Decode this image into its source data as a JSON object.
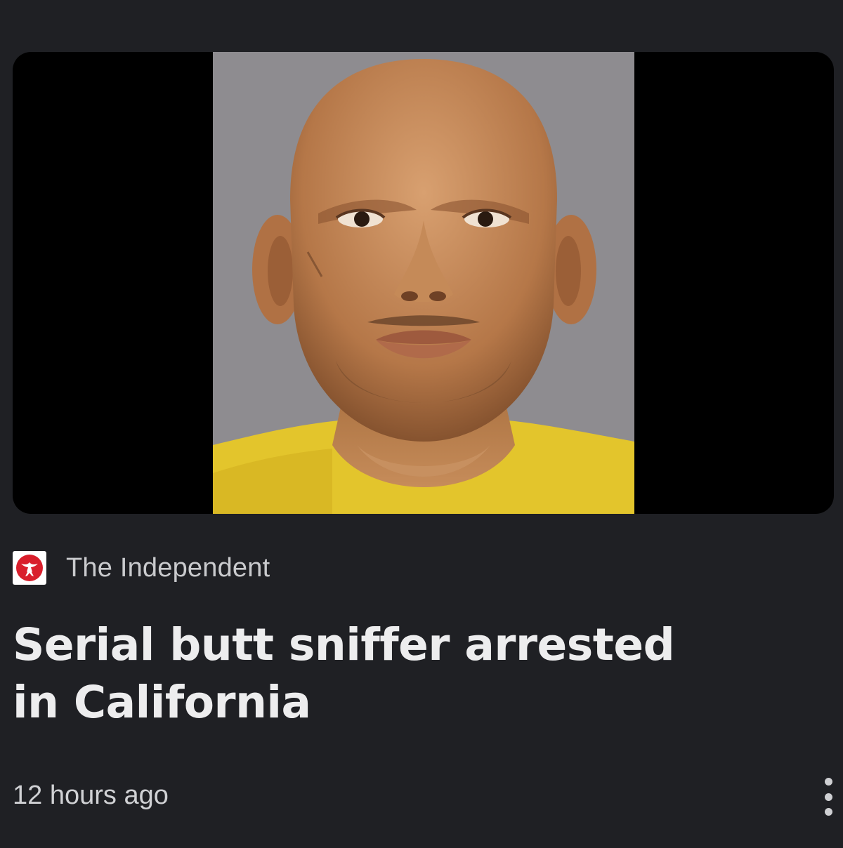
{
  "article": {
    "source_name": "The Independent",
    "headline": "Serial butt sniffer arrested in California",
    "timestamp": "12 hours ago"
  },
  "icons": {
    "source_logo": "eagle-logo-icon",
    "more_menu": "more-vert-icon"
  },
  "colors": {
    "background": "#1f2024",
    "logo_red": "#d91f2c",
    "photo_backdrop": "#8d8b8e",
    "shirt_yellow": "#e4c72e"
  }
}
